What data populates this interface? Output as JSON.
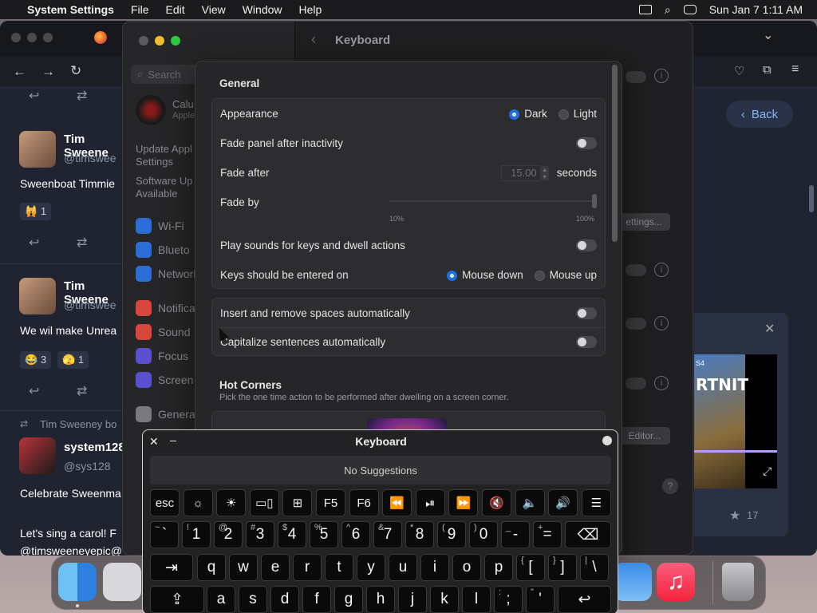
{
  "menubar": {
    "app_name": "System Settings",
    "menus": [
      "File",
      "Edit",
      "View",
      "Window",
      "Help"
    ],
    "datetime": "Sun Jan 7  1:11 AM"
  },
  "browser": {
    "feed": {
      "tweets": [
        {
          "name": "Tim Sweene",
          "handle": "@timswee",
          "text": "Sweenboat Timmie",
          "reactions": [
            {
              "emoji": "🙀",
              "count": "1"
            }
          ]
        },
        {
          "name": "Tim Sweene",
          "handle": "@timswee",
          "text": "We wil make Unrea",
          "reactions": [
            {
              "emoji": "😂",
              "count": "3"
            },
            {
              "emoji": "🫣",
              "count": "1"
            }
          ]
        },
        {
          "boost_label": "Tim Sweeney bo",
          "name": "system128",
          "handle": "@sys128",
          "text": "Celebrate Sweenma",
          "text2": "Let's sing a carol! F",
          "text3": "@timsweeneyepic@"
        }
      ]
    },
    "right": {
      "back_label": "Back",
      "stars": "17",
      "game_text": "RTNIT",
      "ps_label": "S4"
    }
  },
  "settings": {
    "title": "Keyboard",
    "search_placeholder": "Search",
    "account": {
      "name": "Calu",
      "sub": "Apple"
    },
    "update_label": "Update Appl Settings",
    "software_label": "Software Up Available",
    "sidebar_items": [
      "Wi-Fi",
      "Blueto",
      "Network",
      "Notifica",
      "Sound",
      "Focus",
      "Screen T",
      "General"
    ],
    "behind_buttons": [
      "ettings...",
      "Editor..."
    ]
  },
  "sheet": {
    "general_title": "General",
    "appearance_label": "Appearance",
    "dark_label": "Dark",
    "light_label": "Light",
    "fade_inactivity_label": "Fade panel after inactivity",
    "fade_after_label": "Fade after",
    "fade_after_value": "15.00",
    "seconds_label": "seconds",
    "fade_by_label": "Fade by",
    "fade_by_min": "10%",
    "fade_by_max": "100%",
    "fade_by_level": 1.0,
    "play_sounds_label": "Play sounds for keys and dwell actions",
    "keys_entered_label": "Keys should be entered on",
    "mouse_down_label": "Mouse down",
    "mouse_up_label": "Mouse up",
    "insert_spaces_label": "Insert and remove spaces automatically",
    "capitalize_label": "Capitalize sentences automatically",
    "hot_corners_title": "Hot Corners",
    "hot_corners_desc": "Pick the one time action to be performed after dwelling on a screen corner."
  },
  "keyboard": {
    "title": "Keyboard",
    "suggestions": "No Suggestions",
    "fn_row": [
      "esc",
      "☼",
      "☀",
      "▭▯",
      "⊞",
      "F5",
      "F6",
      "⏪",
      "⏯",
      "⏩",
      "🔇",
      "🔈",
      "🔊",
      "☰"
    ],
    "num_row": [
      [
        "~",
        "`"
      ],
      [
        "!",
        "1"
      ],
      [
        "@",
        "2"
      ],
      [
        "#",
        "3"
      ],
      [
        "$",
        "4"
      ],
      [
        "%",
        "5"
      ],
      [
        "^",
        "6"
      ],
      [
        "&",
        "7"
      ],
      [
        "*",
        "8"
      ],
      [
        "(",
        "9"
      ],
      [
        ")",
        "0"
      ],
      [
        "_",
        "-"
      ],
      [
        "+",
        "="
      ]
    ],
    "delete_key": "⌫",
    "tab_key": "⇥",
    "q_row": [
      "q",
      "w",
      "e",
      "r",
      "t",
      "y",
      "u",
      "i",
      "o",
      "p"
    ],
    "q_row_extra": [
      [
        "{",
        "["
      ],
      [
        "}",
        "]"
      ],
      [
        "|",
        "\\"
      ]
    ],
    "shift_key": "⇪",
    "a_row": [
      "a",
      "s",
      "d",
      "f",
      "g",
      "h",
      "j",
      "k",
      "l"
    ],
    "a_row_extra": [
      [
        ":",
        ";"
      ],
      [
        "\"",
        "'"
      ]
    ],
    "return_key": "↩"
  }
}
